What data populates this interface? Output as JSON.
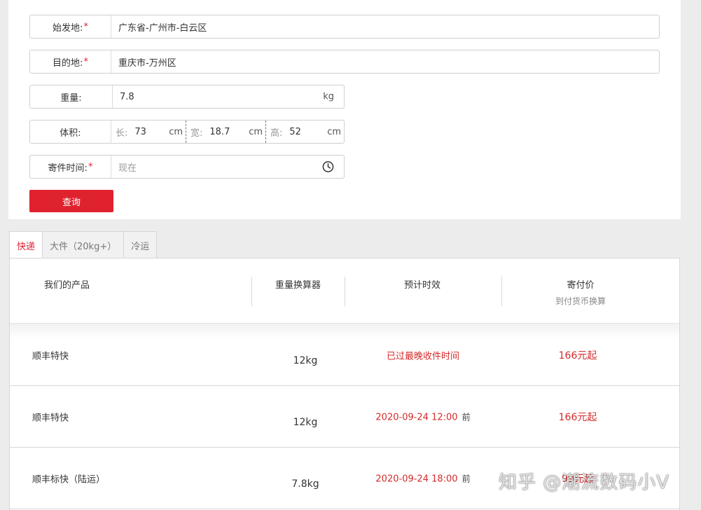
{
  "form": {
    "origin": {
      "label": "始发地:",
      "required": "*",
      "value": "广东省-广州市-白云区"
    },
    "destination": {
      "label": "目的地:",
      "required": "*",
      "value": "重庆市-万州区"
    },
    "weight": {
      "label": "重量:",
      "value": "7.8",
      "unit": "kg"
    },
    "volume": {
      "label": "体积:",
      "length": {
        "label": "长:",
        "value": "73",
        "unit": "cm"
      },
      "width": {
        "label": "宽:",
        "value": "18.7",
        "unit": "cm"
      },
      "height": {
        "label": "高:",
        "value": "52",
        "unit": "cm"
      }
    },
    "send_time": {
      "label": "寄件时间:",
      "required": "*",
      "placeholder": "现在",
      "icon": "clock-icon"
    },
    "query_button": "查询"
  },
  "tabs": [
    {
      "label": "快递",
      "active": true
    },
    {
      "label": "大件（20kg+）",
      "active": false
    },
    {
      "label": "冷运",
      "active": false
    }
  ],
  "table": {
    "headers": {
      "product": "我们的产品",
      "weight_calc": "重量换算器",
      "eta": "预计时效",
      "price": "寄付价",
      "price_sub": "到付货币换算"
    },
    "rows": [
      {
        "name": "顺丰特快",
        "weight": "12kg",
        "eta": "已过最晚收件时间",
        "eta_suffix": "",
        "price": "166元起"
      },
      {
        "name": "顺丰特快",
        "weight": "12kg",
        "eta": "2020-09-24 12:00",
        "eta_suffix": "前",
        "price": "166元起"
      },
      {
        "name": "顺丰标快（陆运）",
        "weight": "7.8kg",
        "eta": "2020-09-24 18:00",
        "eta_suffix": "前",
        "price": "99元起"
      }
    ]
  },
  "watermark": "知乎 @潮流数码小V",
  "colors": {
    "accent": "#e0222f",
    "price": "#d52a2a"
  }
}
